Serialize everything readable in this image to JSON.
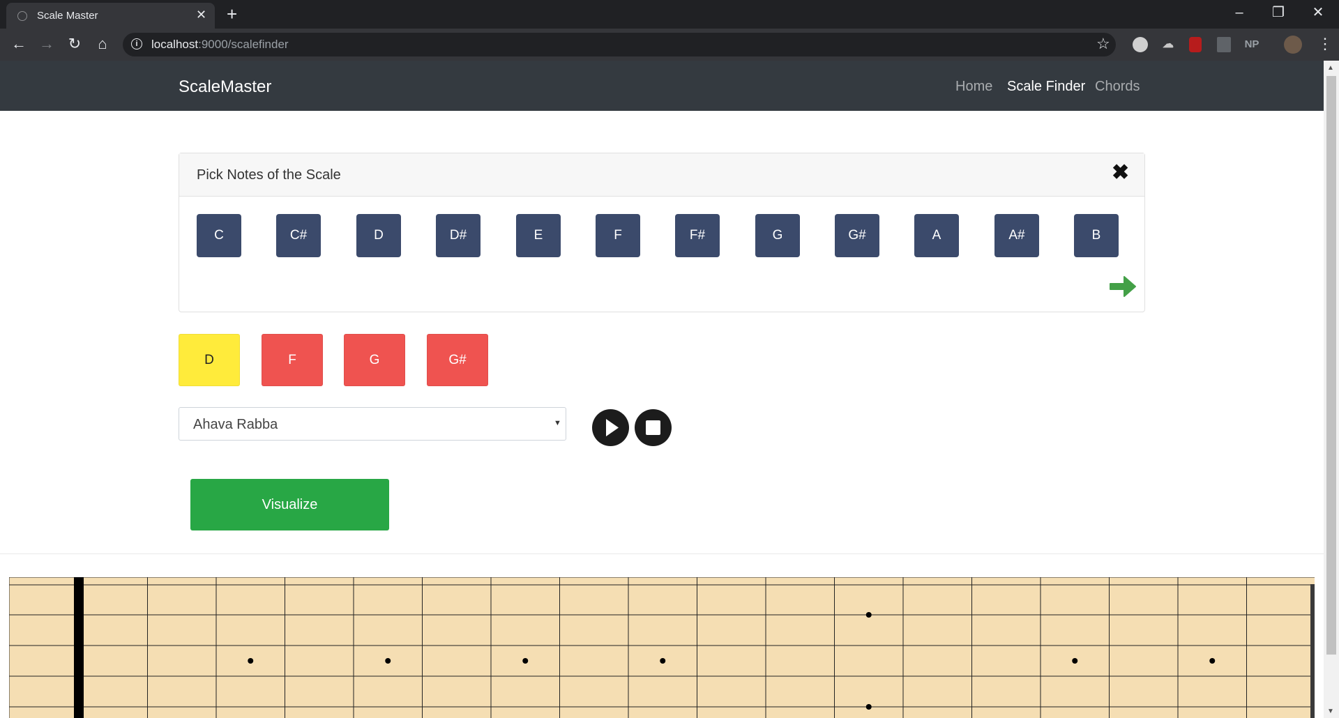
{
  "browser": {
    "tab_title": "Scale Master",
    "url_host": "localhost",
    "url_path": ":9000/scalefinder",
    "ext_np": "NP"
  },
  "navbar": {
    "brand": "ScaleMaster",
    "links": [
      {
        "label": "Home",
        "active": false
      },
      {
        "label": "Scale Finder",
        "active": true
      },
      {
        "label": "Chords",
        "active": false
      }
    ]
  },
  "card": {
    "title": "Pick Notes of the Scale",
    "notes": [
      "C",
      "C#",
      "D",
      "D#",
      "E",
      "F",
      "F#",
      "G",
      "G#",
      "A",
      "A#",
      "B"
    ]
  },
  "selected_notes": [
    {
      "label": "D",
      "color": "#ffeb3b"
    },
    {
      "label": "F",
      "color": "#ef5350"
    },
    {
      "label": "G",
      "color": "#ef5350"
    },
    {
      "label": "G#",
      "color": "#ef5350"
    }
  ],
  "scale_select": {
    "value": "Ahava Rabba"
  },
  "buttons": {
    "visualize": "Visualize"
  },
  "colors": {
    "navbar_bg": "#343a40",
    "note_button": "#3b4a6b",
    "visualize": "#28a745",
    "next_arrow": "#43a047",
    "fretboard": "#f5deb3"
  },
  "icons": {
    "play": "play-icon",
    "stop": "stop-icon",
    "close": "close-icon",
    "next": "arrow-right-icon"
  },
  "fretboard": {
    "frets": 18,
    "strings": 6,
    "single_markers": [
      3,
      5,
      7,
      9,
      15,
      17
    ],
    "double_marker": 12
  }
}
